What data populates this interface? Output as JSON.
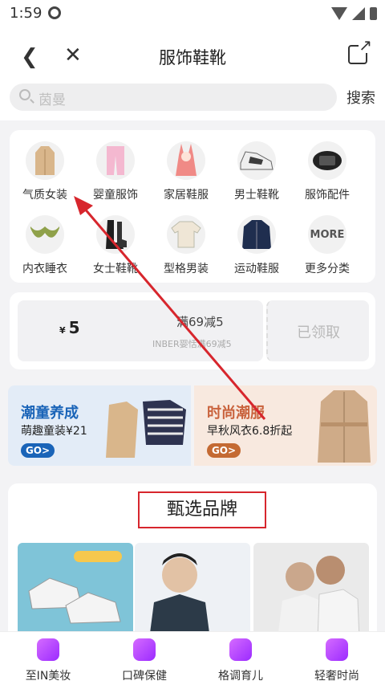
{
  "status": {
    "time": "1:59"
  },
  "nav": {
    "title": "服饰鞋靴",
    "back_icon": "back-icon",
    "close_icon": "close-icon",
    "share_icon": "share-icon"
  },
  "search": {
    "placeholder": "茵曼",
    "button": "搜索"
  },
  "categories": [
    {
      "label": "气质女装"
    },
    {
      "label": "婴童服饰"
    },
    {
      "label": "家居鞋服"
    },
    {
      "label": "男士鞋靴"
    },
    {
      "label": "服饰配件"
    },
    {
      "label": "内衣睡衣"
    },
    {
      "label": "女士鞋靴"
    },
    {
      "label": "型格男装"
    },
    {
      "label": "运动鞋服"
    },
    {
      "label": "更多分类",
      "icon_text": "MORE"
    }
  ],
  "coupon": {
    "currency": "¥",
    "amount": "5",
    "title": "满69减5",
    "desc": "INBER婴恬满69减5",
    "status": "已领取"
  },
  "banners": [
    {
      "title": "潮童养成",
      "subtitle": "萌趣童装¥21",
      "go": "GO>"
    },
    {
      "title": "时尚潮服",
      "subtitle": "早秋风衣6.8折起",
      "go": "GO>"
    }
  ],
  "brands": {
    "title": "甄选品牌"
  },
  "tabs": [
    {
      "label": "至IN美妆"
    },
    {
      "label": "口碑保健"
    },
    {
      "label": "格调育儿"
    },
    {
      "label": "轻奢时尚"
    }
  ],
  "colors": {
    "accent_purple": "#b14cff",
    "annotation_red": "#d7262d",
    "go_blue": "#1a64b8",
    "go_orange": "#c46a33"
  }
}
